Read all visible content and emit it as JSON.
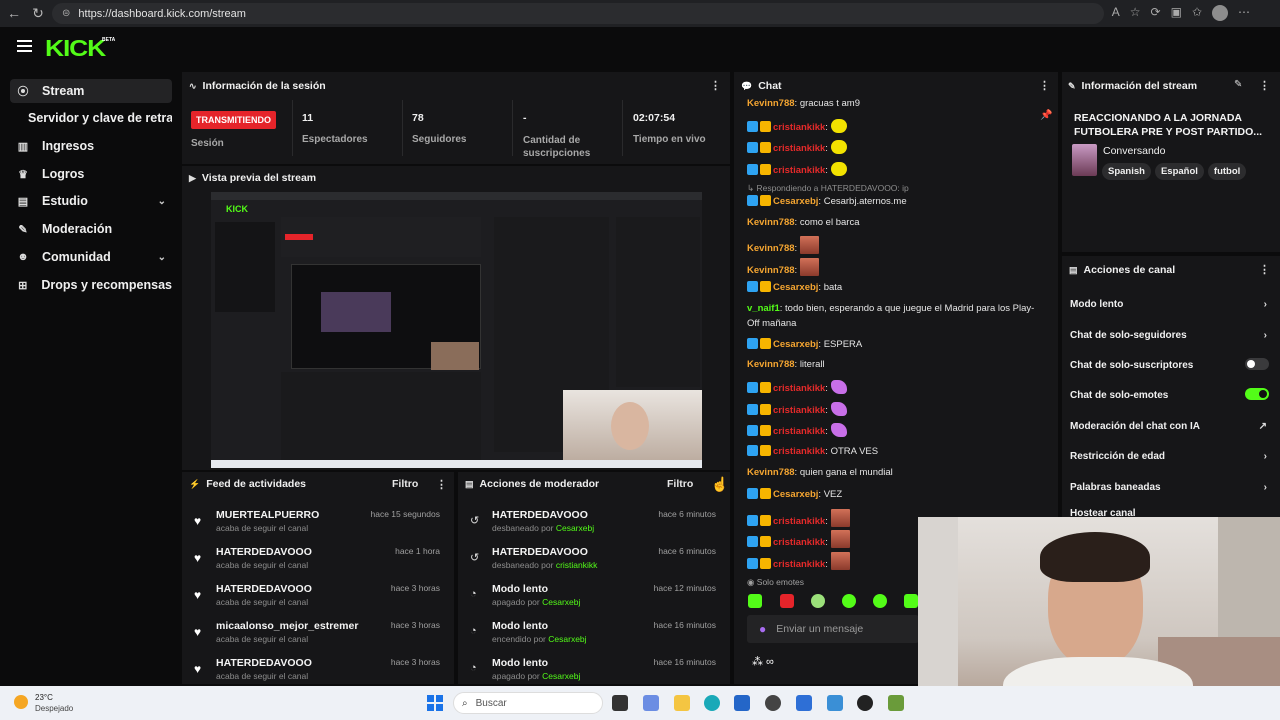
{
  "browser": {
    "url": "https://dashboard.kick.com/stream"
  },
  "app": {
    "logo": "KICK",
    "logo_badge": "BETA"
  },
  "sidebar": {
    "items": [
      {
        "label": "Stream",
        "icon": "stream-icon"
      },
      {
        "label": "Servidor y clave de retransmisión",
        "icon": ""
      },
      {
        "label": "Ingresos",
        "icon": "chart-icon"
      },
      {
        "label": "Logros",
        "icon": "trophy-icon"
      },
      {
        "label": "Estudio",
        "icon": "studio-icon"
      },
      {
        "label": "Moderación",
        "icon": "wrench-icon"
      },
      {
        "label": "Comunidad",
        "icon": "people-icon"
      },
      {
        "label": "Drops y recompensas",
        "icon": "gift-icon"
      }
    ]
  },
  "session": {
    "title": "Información de la sesión",
    "status_badge": "TRANSMITIENDO",
    "status_label": "Sesión",
    "viewers": "11",
    "viewers_label": "Espectadores",
    "followers": "78",
    "followers_label": "Seguidores",
    "subs": "-",
    "subs_label": "Cantidad de suscripciones",
    "live_time": "02:07:54",
    "live_time_label": "Tiempo en vivo"
  },
  "preview": {
    "title": "Vista previa del stream"
  },
  "feed": {
    "title": "Feed de actividades",
    "filter": "Filtro",
    "items": [
      {
        "name": "MUERTEALPUERRO",
        "sub": "acaba de seguir el canal",
        "time": "hace 15 segundos"
      },
      {
        "name": "HATERDEDAVOOO",
        "sub": "acaba de seguir el canal",
        "time": "hace 1 hora"
      },
      {
        "name": "HATERDEDAVOOO",
        "sub": "acaba de seguir el canal",
        "time": "hace 3 horas"
      },
      {
        "name": "micaalonso_mejor_estremer",
        "sub": "acaba de seguir el canal",
        "time": "hace 3 horas"
      },
      {
        "name": "HATERDEDAVOOO",
        "sub": "acaba de seguir el canal",
        "time": "hace 3 horas"
      }
    ]
  },
  "mod_actions": {
    "title": "Acciones de moderador",
    "filter": "Filtro",
    "items": [
      {
        "name": "HATERDEDAVOOO",
        "action": "desbaneado por",
        "by": "Cesarxebj",
        "time": "hace 6 minutos",
        "icon": "undo-icon"
      },
      {
        "name": "HATERDEDAVOOO",
        "action": "desbaneado por",
        "by": "cristiankikk",
        "time": "hace 6 minutos",
        "icon": "undo-icon"
      },
      {
        "name": "Modo lento",
        "action": "apagado por",
        "by": "Cesarxebj",
        "time": "hace 12 minutos",
        "icon": "slow-icon"
      },
      {
        "name": "Modo lento",
        "action": "encendido por",
        "by": "Cesarxebj",
        "time": "hace 16 minutos",
        "icon": "slow-icon"
      },
      {
        "name": "Modo lento",
        "action": "apagado por",
        "by": "Cesarxebj",
        "time": "hace 16 minutos",
        "icon": "slow-icon"
      }
    ]
  },
  "chat": {
    "title": "Chat",
    "replying": "Respondiendo a HATERDEDAVOOO: ip",
    "emote_mode": "Solo emotes",
    "input_placeholder": "Enviar un mensaje",
    "messages": [
      {
        "user": "Kevinn788",
        "text": "gracuas t am9"
      },
      {
        "user": "cristiankikk",
        "text": ""
      },
      {
        "user": "cristiankikk",
        "text": ""
      },
      {
        "user": "cristiankikk",
        "text": ""
      },
      {
        "user": "Cesarxebj",
        "text": "Cesarbj.aternos.me"
      },
      {
        "user": "Kevinn788",
        "text": "como el barca"
      },
      {
        "user": "Kevinn788",
        "text": ""
      },
      {
        "user": "Kevinn788",
        "text": ""
      },
      {
        "user": "Cesarxebj",
        "text": "bata"
      },
      {
        "user": "v_naif1",
        "text": "todo bien, esperando a que juegue el Madrid para los Play-"
      },
      {
        "user": "",
        "text": "Off mañana"
      },
      {
        "user": "Cesarxebj",
        "text": "ESPERA"
      },
      {
        "user": "Kevinn788",
        "text": "literall"
      },
      {
        "user": "cristiankikk",
        "text": ""
      },
      {
        "user": "cristiankikk",
        "text": ""
      },
      {
        "user": "cristiankikk",
        "text": ""
      },
      {
        "user": "cristiankikk",
        "text": "OTRA VES"
      },
      {
        "user": "Kevinn788",
        "text": "quien gana el mundial"
      },
      {
        "user": "Cesarxebj",
        "text": "VEZ"
      },
      {
        "user": "cristiankikk",
        "text": ""
      },
      {
        "user": "cristiankikk",
        "text": ""
      },
      {
        "user": "cristiankikk",
        "text": ""
      }
    ]
  },
  "stream_info": {
    "title": "Información del stream",
    "stream_title": "REACCIONANDO A LA JORNADA FUTBOLERA PRE Y POST PARTIDO...",
    "category": "Conversando",
    "tags": [
      "Spanish",
      "Español",
      "futbol"
    ]
  },
  "channel_actions": {
    "title": "Acciones de canal",
    "items": [
      {
        "label": "Modo lento",
        "control": "chevron"
      },
      {
        "label": "Chat de solo-seguidores",
        "control": "chevron"
      },
      {
        "label": "Chat de solo-suscriptores",
        "control": "toggle-off"
      },
      {
        "label": "Chat de solo-emotes",
        "control": "toggle-on"
      },
      {
        "label": "Moderación del chat con IA",
        "control": "external"
      },
      {
        "label": "Restricción de edad",
        "control": "chevron"
      },
      {
        "label": "Palabras baneadas",
        "control": "chevron"
      },
      {
        "label": "Hostear canal",
        "control": ""
      }
    ]
  },
  "taskbar": {
    "weather_temp": "23°C",
    "weather_desc": "Despejado",
    "search": "Buscar"
  },
  "colors": {
    "accent": "#53fc18",
    "live": "#e5242a",
    "background": "#0b0b0c",
    "panel": "#161618"
  }
}
